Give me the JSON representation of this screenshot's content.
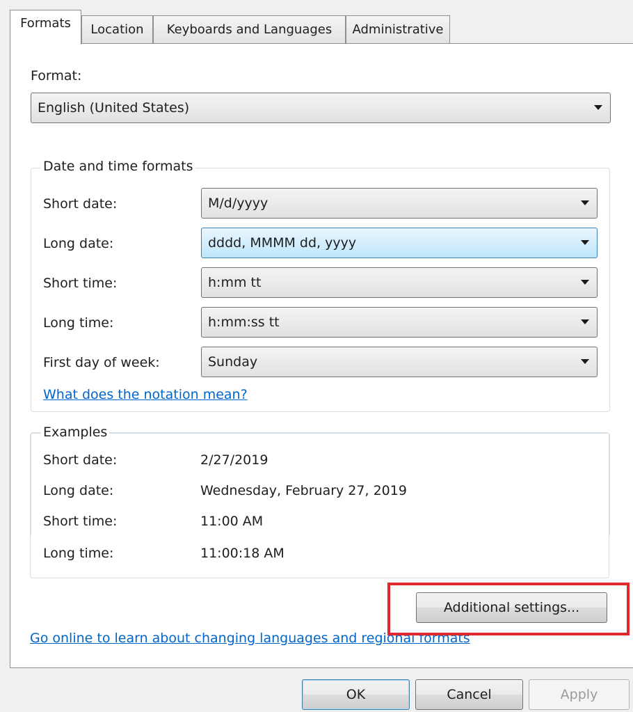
{
  "tabs": [
    {
      "label": "Formats",
      "active": true
    },
    {
      "label": "Location",
      "active": false
    },
    {
      "label": "Keyboards and Languages",
      "active": false
    },
    {
      "label": "Administrative",
      "active": false
    }
  ],
  "format": {
    "label": "Format:",
    "value": "English (United States)"
  },
  "date_time_formats": {
    "title": "Date and time formats",
    "short_date": {
      "label": "Short date:",
      "value": "M/d/yyyy"
    },
    "long_date": {
      "label": "Long date:",
      "value": "dddd, MMMM dd, yyyy"
    },
    "short_time": {
      "label": "Short time:",
      "value": "h:mm tt"
    },
    "long_time": {
      "label": "Long time:",
      "value": "h:mm:ss tt"
    },
    "first_day": {
      "label": "First day of week:",
      "value": "Sunday"
    },
    "notation_link": "What does the notation mean?"
  },
  "examples": {
    "title": "Examples",
    "short_date": {
      "label": "Short date:",
      "value": "2/27/2019"
    },
    "long_date": {
      "label": "Long date:",
      "value": "Wednesday, February 27, 2019"
    },
    "short_time": {
      "label": "Short time:",
      "value": "11:00 AM"
    },
    "long_time": {
      "label": "Long time:",
      "value": "11:00:18 AM"
    }
  },
  "additional_settings_label": "Additional settings...",
  "online_link": "Go online to learn about changing languages and regional formats",
  "buttons": {
    "ok": "OK",
    "cancel": "Cancel",
    "apply": "Apply"
  },
  "colors": {
    "link": "#0066cc",
    "highlight": "#e0262e",
    "focus": "#3c7fb1"
  }
}
